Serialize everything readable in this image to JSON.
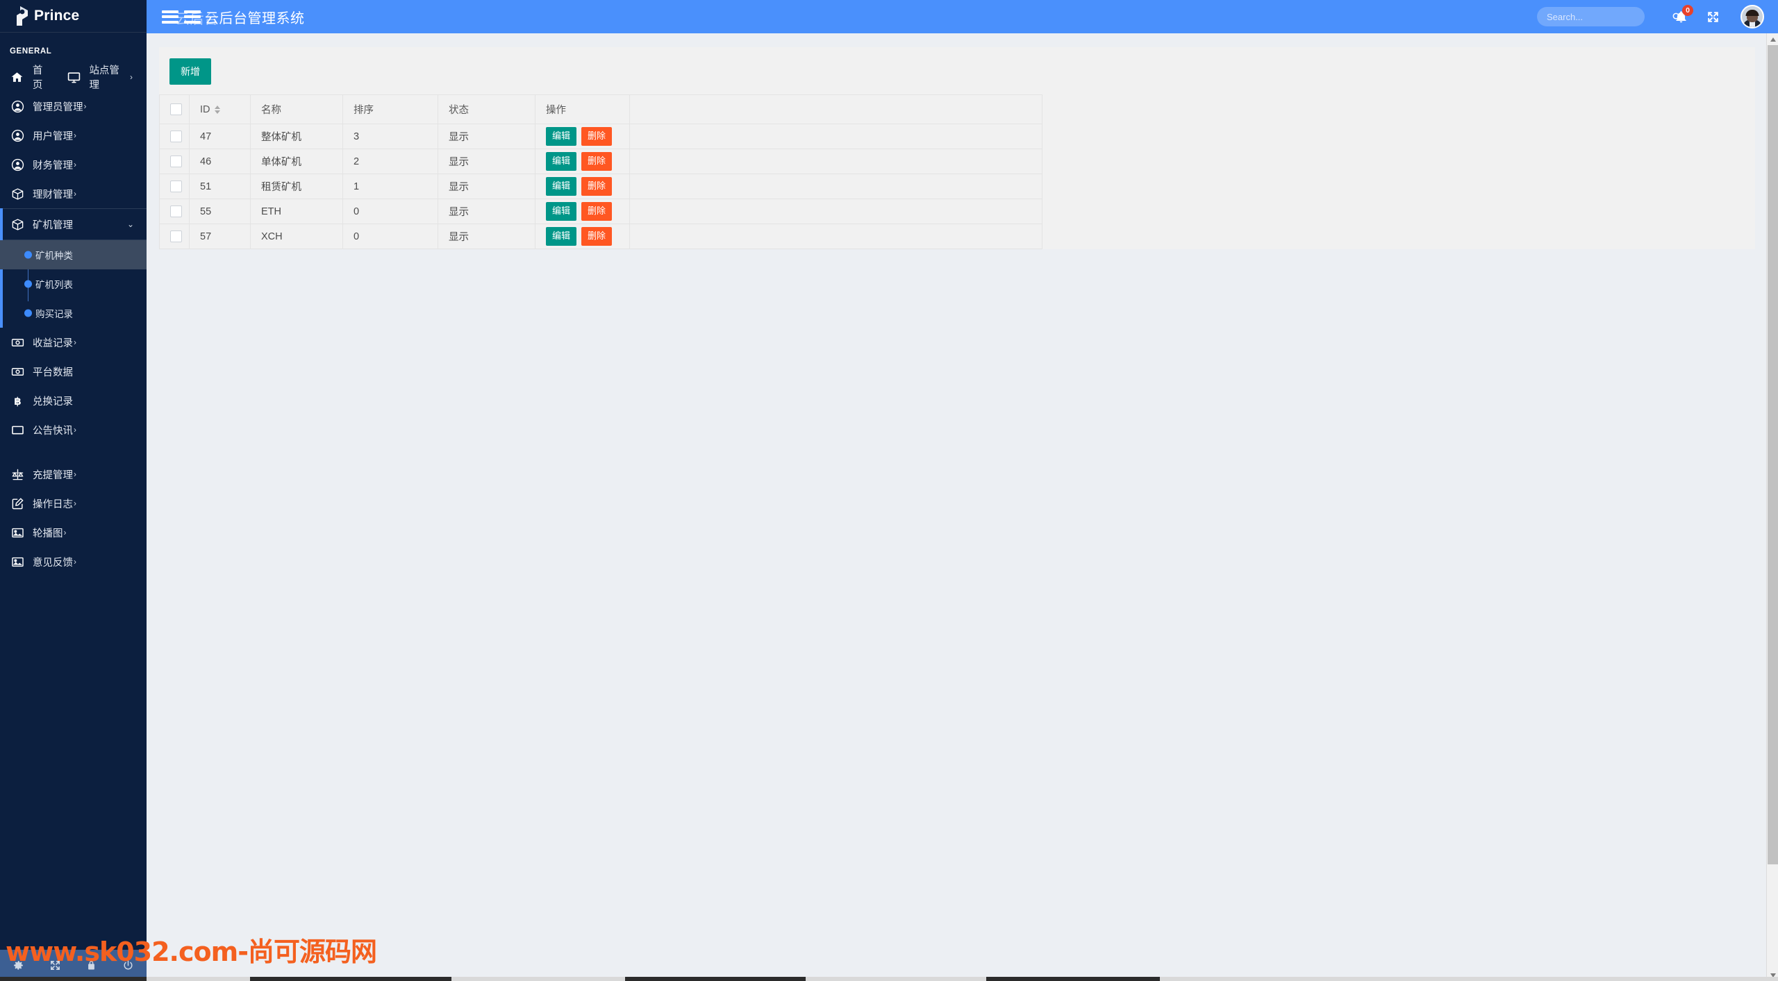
{
  "brand": {
    "name": "Prince",
    "logo_icon": "prince-logo-icon"
  },
  "sidebar": {
    "section_label": "GENERAL",
    "top_row": [
      {
        "label": "首页",
        "icon": "home-icon"
      },
      {
        "label": "站点管理",
        "icon": "monitor-icon",
        "caret": "›"
      }
    ],
    "items": [
      {
        "label": "管理员管理",
        "icon": "user-circle-icon",
        "caret": "›"
      },
      {
        "label": "用户管理",
        "icon": "user-circle-icon",
        "caret": "›"
      },
      {
        "label": "财务管理",
        "icon": "user-circle-icon",
        "caret": "›"
      },
      {
        "label": "理财管理",
        "icon": "cube-icon",
        "caret": "›"
      }
    ],
    "active_group": {
      "label": "矿机管理",
      "icon": "cube-icon",
      "chevron": "⌄",
      "children": [
        {
          "label": "矿机种类",
          "active": true
        },
        {
          "label": "矿机列表",
          "active": false
        },
        {
          "label": "购买记录",
          "active": false
        }
      ]
    },
    "items_after": [
      {
        "label": "收益记录",
        "icon": "money-icon",
        "caret": "›"
      },
      {
        "label": "平台数据",
        "icon": "money-icon",
        "caret": ""
      },
      {
        "label": "兑换记录",
        "icon": "bitcoin-icon",
        "caret": ""
      },
      {
        "label": "公告快讯",
        "icon": "window-icon",
        "caret": "›"
      }
    ],
    "items_bottom": [
      {
        "label": "充提管理",
        "icon": "scale-icon",
        "caret": "›"
      },
      {
        "label": "操作日志",
        "icon": "pencil-square-icon",
        "caret": "›"
      },
      {
        "label": "轮播图",
        "icon": "image-icon",
        "caret": "›"
      },
      {
        "label": "意见反馈",
        "icon": "image-icon",
        "caret": "›"
      }
    ],
    "tools": [
      {
        "icon": "gear-icon"
      },
      {
        "icon": "fullscreen-icon"
      },
      {
        "icon": "lock-icon"
      },
      {
        "icon": "power-icon"
      }
    ]
  },
  "header": {
    "menu_icon": "hamburger-icon",
    "menu_icon_2": "hamburger-icon",
    "title": "云后台管理系统",
    "title_ghost": "云后台",
    "search": {
      "value": "",
      "placeholder": "Search...",
      "icon": "search-icon"
    },
    "notifications": {
      "icon": "bell-icon",
      "count": "0"
    },
    "fullscreen_icon": "expand-arrows-icon",
    "avatar": "user-avatar"
  },
  "toolbar": {
    "add_label": "新增"
  },
  "table": {
    "columns": [
      "",
      "ID",
      "名称",
      "排序",
      "状态",
      "操作",
      ""
    ],
    "sort_column": "ID",
    "rows": [
      {
        "id": "47",
        "name": "整体矿机",
        "sort": "3",
        "state": "显示"
      },
      {
        "id": "46",
        "name": "单体矿机",
        "sort": "2",
        "state": "显示"
      },
      {
        "id": "51",
        "name": "租赁矿机",
        "sort": "1",
        "state": "显示"
      },
      {
        "id": "55",
        "name": "ETH",
        "sort": "0",
        "state": "显示"
      },
      {
        "id": "57",
        "name": "XCH",
        "sort": "0",
        "state": "显示"
      }
    ],
    "row_actions": {
      "edit": "编辑",
      "delete": "删除"
    }
  },
  "watermark": {
    "text": "www.sk032.com-尚可源码网",
    "color": "#f4601f"
  },
  "theme": {
    "sidebar_bg": "#0c1f3f",
    "header_blue": "#4a90fc",
    "accent_teal": "#009688",
    "accent_orange": "#ff5722",
    "badge_red": "#e8412a",
    "content_bg": "#eceff3"
  }
}
